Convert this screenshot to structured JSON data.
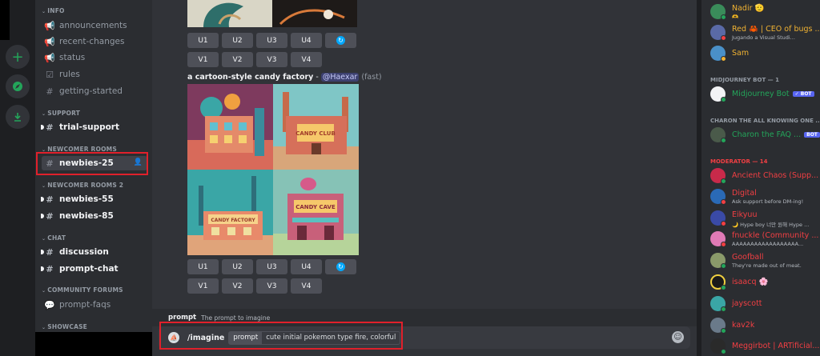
{
  "sidebar": {
    "categories": {
      "info": "INFO",
      "support": "SUPPORT",
      "newcomer": "NEWCOMER ROOMS",
      "newcomer2": "NEWCOMER ROOMS 2",
      "chat": "CHAT",
      "forums": "COMMUNITY FORUMS",
      "showcase": "SHOWCASE"
    },
    "channels": {
      "announcements": "announcements",
      "recent_changes": "recent-changes",
      "status": "status",
      "rules": "rules",
      "getting_started": "getting-started",
      "trial_support": "trial-support",
      "newbies_25": "newbies-25",
      "newbies_55": "newbies-55",
      "newbies_85": "newbies-85",
      "discussion": "discussion",
      "prompt_chat": "prompt-chat",
      "prompt_faqs": "prompt-faqs"
    }
  },
  "chat": {
    "buttons_u": [
      "U1",
      "U2",
      "U3",
      "U4"
    ],
    "buttons_v": [
      "V1",
      "V2",
      "V3",
      "V4"
    ],
    "message": {
      "prompt_text": "a cartoon-style candy factory",
      "separator": " - ",
      "mention": "@Haexar",
      "mode": "(fast)"
    },
    "images": [
      "candy factory 1",
      "candy factory 2",
      "candy factory 3",
      "candy factory 4"
    ],
    "image_signs": {
      "img2": "CANDY CLUB",
      "img3": "CANDY FACTORY",
      "img4": "CANDY CAVE"
    },
    "command_hint": {
      "name": "prompt",
      "desc": "The prompt to imagine"
    },
    "composer": {
      "command": "/imagine",
      "option_key": "prompt",
      "option_value": "cute initial pokemon type fire, colorful"
    }
  },
  "members": {
    "top": [
      {
        "name": "Nadir 🫡",
        "sub": "🫶",
        "color": "#f0b232"
      },
      {
        "name": "Red 🦀 | CEO of bugs ...",
        "sub": "Jugando a Visual Studi...",
        "color": "#f0b232"
      },
      {
        "name": "Sam",
        "sub": "",
        "color": "#f0b232"
      }
    ],
    "cat_midjourney": "MIDJOURNEY BOT — 1",
    "midjourney": {
      "name": "Midjourney Bot",
      "badge": "✓ BOT",
      "color": "#23a55a"
    },
    "cat_charon": "CHARON THE ALL KNOWING ONE ...",
    "charon": {
      "name": "Charon the FAQ ...",
      "badge": "BOT",
      "color": "#23a55a"
    },
    "cat_moderator": "MODERATOR — 14",
    "moderators": [
      {
        "name": "Ancient Chaos (Supp...",
        "sub": "",
        "color": "#f23f43"
      },
      {
        "name": "Digital",
        "sub": "Ask support before DM-ing!",
        "color": "#f23f43"
      },
      {
        "name": "Eikyuu",
        "sub": "🌙 Hype boy 너만 원해 Hype ...",
        "color": "#f23f43"
      },
      {
        "name": "fnuckle (Community ...",
        "sub": "AAAAAAAAAAAAAAAAAA...",
        "color": "#f23f43"
      },
      {
        "name": "Goofball",
        "sub": "They're made out of meat.",
        "color": "#f23f43"
      },
      {
        "name": "isaacq 🌸",
        "sub": "",
        "color": "#f23f43"
      },
      {
        "name": "jayscott",
        "sub": "",
        "color": "#f23f43"
      },
      {
        "name": "kav2k",
        "sub": "",
        "color": "#f23f43"
      },
      {
        "name": "Meggirbot | ARTificial...",
        "sub": "",
        "color": "#f23f43"
      }
    ]
  },
  "colors": {
    "highlight": "#e0202b",
    "bg_chat": "#313338",
    "bg_sidebar": "#2b2d31",
    "moderator": "#f23f43",
    "bot_green": "#23a55a",
    "owner_gold": "#f0b232"
  }
}
